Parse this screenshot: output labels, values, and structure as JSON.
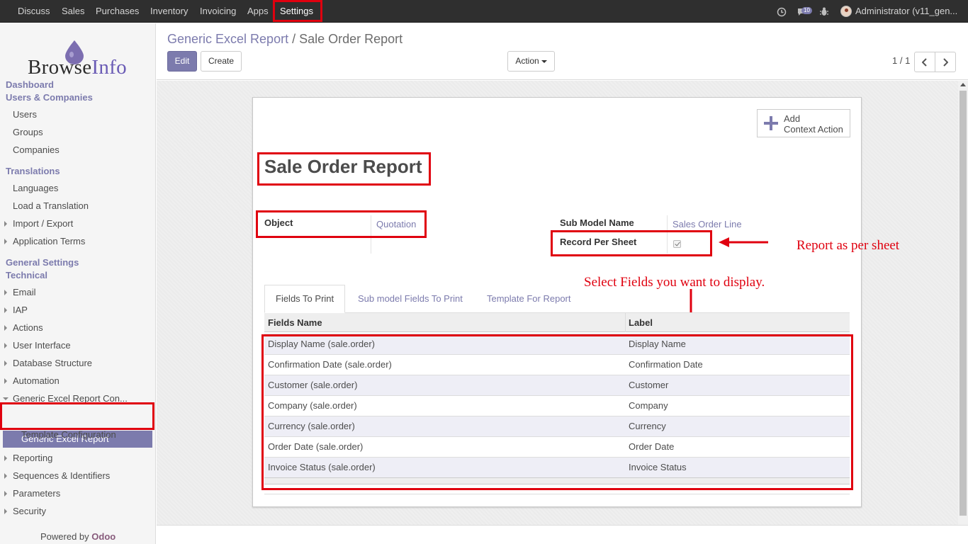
{
  "topbar": {
    "menus": [
      "Discuss",
      "Sales",
      "Purchases",
      "Inventory",
      "Invoicing",
      "Apps",
      "Settings"
    ],
    "active_menu": "Settings",
    "notification_count": "10",
    "user": "Administrator (v11_gen..."
  },
  "sidebar": {
    "logo": {
      "part1": "Browse",
      "part2": "Info"
    },
    "dashboard": "Dashboard",
    "users_companies": "Users & Companies",
    "users": "Users",
    "groups": "Groups",
    "companies": "Companies",
    "translations": "Translations",
    "languages": "Languages",
    "load_translation": "Load a Translation",
    "import_export": "Import / Export",
    "application_terms": "Application Terms",
    "general_settings": "General Settings",
    "technical": "Technical",
    "email": "Email",
    "iap": "IAP",
    "actions": "Actions",
    "user_interface": "User Interface",
    "database_structure": "Database Structure",
    "automation": "Automation",
    "generic_excel_config": "Generic Excel Report Con...",
    "generic_excel_report": "Generic Excel Report",
    "template_configuration": "Template Configuration",
    "reporting": "Reporting",
    "sequences": "Sequences & Identifiers",
    "parameters": "Parameters",
    "security": "Security",
    "powered_by": "Powered by ",
    "odoo": "Odoo"
  },
  "control_panel": {
    "breadcrumb_link": "Generic Excel Report",
    "breadcrumb_sep": " / ",
    "breadcrumb_current": "Sale Order Report",
    "edit": "Edit",
    "create": "Create",
    "action": "Action",
    "pager": "1 / 1"
  },
  "form": {
    "context_action_line1": "Add",
    "context_action_line2": "Context Action",
    "title": "Sale Order Report",
    "object_label": "Object",
    "object_value": "Quotation",
    "sub_model_label": "Sub Model Name",
    "sub_model_value": "Sales Order Line",
    "record_per_sheet_label": "Record Per Sheet",
    "record_per_sheet_checked": true,
    "tabs": [
      "Fields To Print",
      "Sub model Fields To Print",
      "Template For Report"
    ],
    "table_headers": [
      "Fields Name",
      "Label"
    ],
    "rows": [
      {
        "field": "Display Name (sale.order)",
        "label": "Display Name"
      },
      {
        "field": "Confirmation Date (sale.order)",
        "label": "Confirmation Date"
      },
      {
        "field": "Customer (sale.order)",
        "label": "Customer"
      },
      {
        "field": "Company (sale.order)",
        "label": "Company"
      },
      {
        "field": "Currency (sale.order)",
        "label": "Currency"
      },
      {
        "field": "Order Date (sale.order)",
        "label": "Order Date"
      },
      {
        "field": "Invoice Status (sale.order)",
        "label": "Invoice Status"
      }
    ]
  },
  "annotations": {
    "report_per_sheet": "Report as per sheet",
    "select_fields": "Select Fields you want to display."
  },
  "colors": {
    "accent": "#7c7bad",
    "annotation": "#e0000f",
    "topbar": "#2f2f2f"
  }
}
